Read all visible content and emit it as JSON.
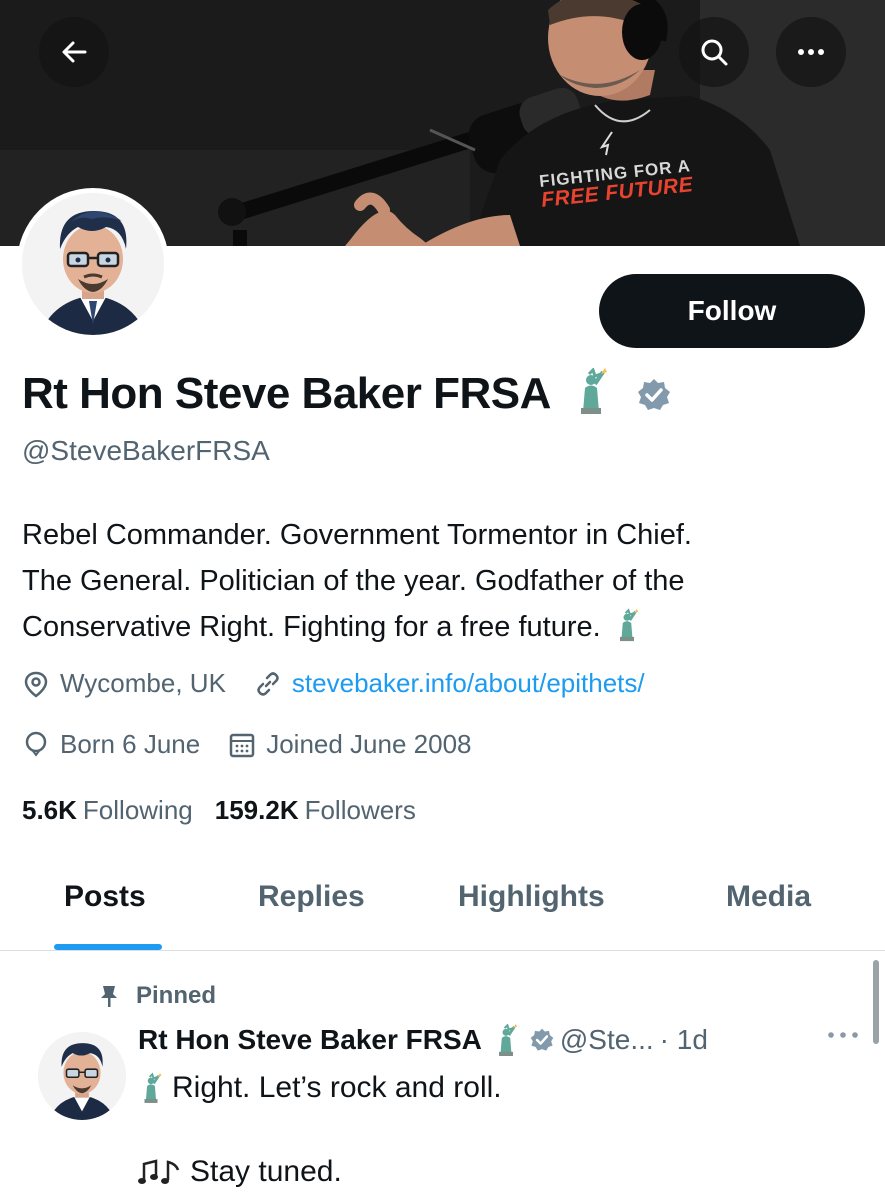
{
  "banner": {
    "shirt_line1": "FIGHTING FOR A",
    "shirt_line2": "FREE FUTURE"
  },
  "topbar": {
    "back_icon": "arrow-left-icon",
    "search_icon": "search-icon",
    "more_icon": "more-horizontal-icon"
  },
  "profile": {
    "follow_label": "Follow",
    "display_name": "Rt Hon Steve Baker FRSA",
    "handle": "@SteveBakerFRSA",
    "bio_lines": [
      "Rebel Commander. Government Tormentor in Chief.",
      "The General. Politician of the year. Godfather of the",
      "Conservative Right. Fighting for a free future."
    ],
    "location": "Wycombe, UK",
    "website": "stevebaker.info/about/epithets/",
    "birthday": "Born 6 June",
    "joined": "Joined June 2008",
    "following_count": "5.6K",
    "following_label": "Following",
    "followers_count": "159.2K",
    "followers_label": "Followers"
  },
  "tabs": [
    {
      "label": "Posts",
      "active": true
    },
    {
      "label": "Replies",
      "active": false
    },
    {
      "label": "Highlights",
      "active": false
    },
    {
      "label": "Media",
      "active": false
    }
  ],
  "pinned_post": {
    "pinned_label": "Pinned",
    "author_name": "Rt Hon Steve Baker FRSA",
    "handle_truncated": "@Ste...",
    "time": "· 1d",
    "text_line1": "Right. Let’s rock and roll.",
    "text_line2": "Stay tuned."
  },
  "colors": {
    "accent": "#1d9bf0",
    "text_primary": "#0f1419",
    "text_secondary": "#536471",
    "verified_badge": "#829aab",
    "statue_green": "#5fa89a"
  }
}
